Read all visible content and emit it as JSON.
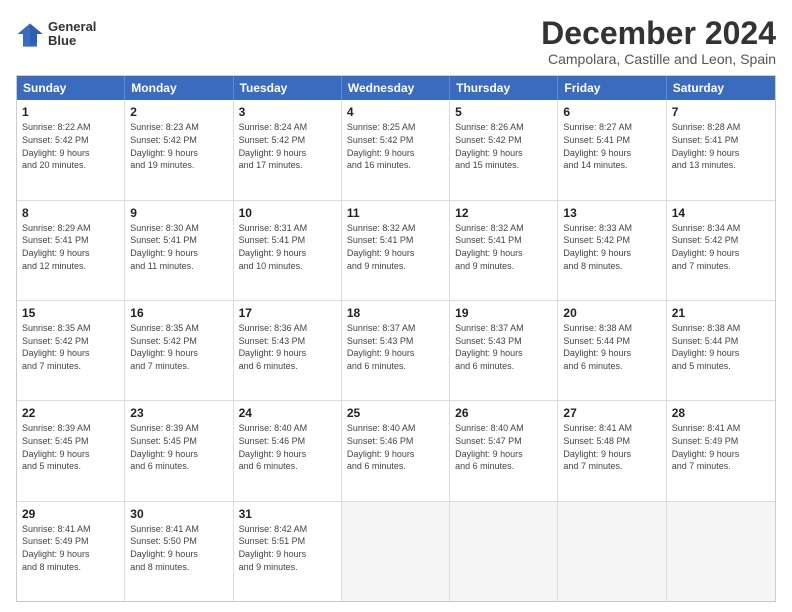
{
  "logo": {
    "line1": "General",
    "line2": "Blue"
  },
  "title": "December 2024",
  "subtitle": "Campolara, Castille and Leon, Spain",
  "weekdays": [
    "Sunday",
    "Monday",
    "Tuesday",
    "Wednesday",
    "Thursday",
    "Friday",
    "Saturday"
  ],
  "rows": [
    [
      {
        "day": "1",
        "lines": [
          "Sunrise: 8:22 AM",
          "Sunset: 5:42 PM",
          "Daylight: 9 hours",
          "and 20 minutes."
        ]
      },
      {
        "day": "2",
        "lines": [
          "Sunrise: 8:23 AM",
          "Sunset: 5:42 PM",
          "Daylight: 9 hours",
          "and 19 minutes."
        ]
      },
      {
        "day": "3",
        "lines": [
          "Sunrise: 8:24 AM",
          "Sunset: 5:42 PM",
          "Daylight: 9 hours",
          "and 17 minutes."
        ]
      },
      {
        "day": "4",
        "lines": [
          "Sunrise: 8:25 AM",
          "Sunset: 5:42 PM",
          "Daylight: 9 hours",
          "and 16 minutes."
        ]
      },
      {
        "day": "5",
        "lines": [
          "Sunrise: 8:26 AM",
          "Sunset: 5:42 PM",
          "Daylight: 9 hours",
          "and 15 minutes."
        ]
      },
      {
        "day": "6",
        "lines": [
          "Sunrise: 8:27 AM",
          "Sunset: 5:41 PM",
          "Daylight: 9 hours",
          "and 14 minutes."
        ]
      },
      {
        "day": "7",
        "lines": [
          "Sunrise: 8:28 AM",
          "Sunset: 5:41 PM",
          "Daylight: 9 hours",
          "and 13 minutes."
        ]
      }
    ],
    [
      {
        "day": "8",
        "lines": [
          "Sunrise: 8:29 AM",
          "Sunset: 5:41 PM",
          "Daylight: 9 hours",
          "and 12 minutes."
        ]
      },
      {
        "day": "9",
        "lines": [
          "Sunrise: 8:30 AM",
          "Sunset: 5:41 PM",
          "Daylight: 9 hours",
          "and 11 minutes."
        ]
      },
      {
        "day": "10",
        "lines": [
          "Sunrise: 8:31 AM",
          "Sunset: 5:41 PM",
          "Daylight: 9 hours",
          "and 10 minutes."
        ]
      },
      {
        "day": "11",
        "lines": [
          "Sunrise: 8:32 AM",
          "Sunset: 5:41 PM",
          "Daylight: 9 hours",
          "and 9 minutes."
        ]
      },
      {
        "day": "12",
        "lines": [
          "Sunrise: 8:32 AM",
          "Sunset: 5:41 PM",
          "Daylight: 9 hours",
          "and 9 minutes."
        ]
      },
      {
        "day": "13",
        "lines": [
          "Sunrise: 8:33 AM",
          "Sunset: 5:42 PM",
          "Daylight: 9 hours",
          "and 8 minutes."
        ]
      },
      {
        "day": "14",
        "lines": [
          "Sunrise: 8:34 AM",
          "Sunset: 5:42 PM",
          "Daylight: 9 hours",
          "and 7 minutes."
        ]
      }
    ],
    [
      {
        "day": "15",
        "lines": [
          "Sunrise: 8:35 AM",
          "Sunset: 5:42 PM",
          "Daylight: 9 hours",
          "and 7 minutes."
        ]
      },
      {
        "day": "16",
        "lines": [
          "Sunrise: 8:35 AM",
          "Sunset: 5:42 PM",
          "Daylight: 9 hours",
          "and 7 minutes."
        ]
      },
      {
        "day": "17",
        "lines": [
          "Sunrise: 8:36 AM",
          "Sunset: 5:43 PM",
          "Daylight: 9 hours",
          "and 6 minutes."
        ]
      },
      {
        "day": "18",
        "lines": [
          "Sunrise: 8:37 AM",
          "Sunset: 5:43 PM",
          "Daylight: 9 hours",
          "and 6 minutes."
        ]
      },
      {
        "day": "19",
        "lines": [
          "Sunrise: 8:37 AM",
          "Sunset: 5:43 PM",
          "Daylight: 9 hours",
          "and 6 minutes."
        ]
      },
      {
        "day": "20",
        "lines": [
          "Sunrise: 8:38 AM",
          "Sunset: 5:44 PM",
          "Daylight: 9 hours",
          "and 6 minutes."
        ]
      },
      {
        "day": "21",
        "lines": [
          "Sunrise: 8:38 AM",
          "Sunset: 5:44 PM",
          "Daylight: 9 hours",
          "and 5 minutes."
        ]
      }
    ],
    [
      {
        "day": "22",
        "lines": [
          "Sunrise: 8:39 AM",
          "Sunset: 5:45 PM",
          "Daylight: 9 hours",
          "and 5 minutes."
        ]
      },
      {
        "day": "23",
        "lines": [
          "Sunrise: 8:39 AM",
          "Sunset: 5:45 PM",
          "Daylight: 9 hours",
          "and 6 minutes."
        ]
      },
      {
        "day": "24",
        "lines": [
          "Sunrise: 8:40 AM",
          "Sunset: 5:46 PM",
          "Daylight: 9 hours",
          "and 6 minutes."
        ]
      },
      {
        "day": "25",
        "lines": [
          "Sunrise: 8:40 AM",
          "Sunset: 5:46 PM",
          "Daylight: 9 hours",
          "and 6 minutes."
        ]
      },
      {
        "day": "26",
        "lines": [
          "Sunrise: 8:40 AM",
          "Sunset: 5:47 PM",
          "Daylight: 9 hours",
          "and 6 minutes."
        ]
      },
      {
        "day": "27",
        "lines": [
          "Sunrise: 8:41 AM",
          "Sunset: 5:48 PM",
          "Daylight: 9 hours",
          "and 7 minutes."
        ]
      },
      {
        "day": "28",
        "lines": [
          "Sunrise: 8:41 AM",
          "Sunset: 5:49 PM",
          "Daylight: 9 hours",
          "and 7 minutes."
        ]
      }
    ],
    [
      {
        "day": "29",
        "lines": [
          "Sunrise: 8:41 AM",
          "Sunset: 5:49 PM",
          "Daylight: 9 hours",
          "and 8 minutes."
        ]
      },
      {
        "day": "30",
        "lines": [
          "Sunrise: 8:41 AM",
          "Sunset: 5:50 PM",
          "Daylight: 9 hours",
          "and 8 minutes."
        ]
      },
      {
        "day": "31",
        "lines": [
          "Sunrise: 8:42 AM",
          "Sunset: 5:51 PM",
          "Daylight: 9 hours",
          "and 9 minutes."
        ]
      },
      {
        "day": "",
        "lines": []
      },
      {
        "day": "",
        "lines": []
      },
      {
        "day": "",
        "lines": []
      },
      {
        "day": "",
        "lines": []
      }
    ]
  ]
}
